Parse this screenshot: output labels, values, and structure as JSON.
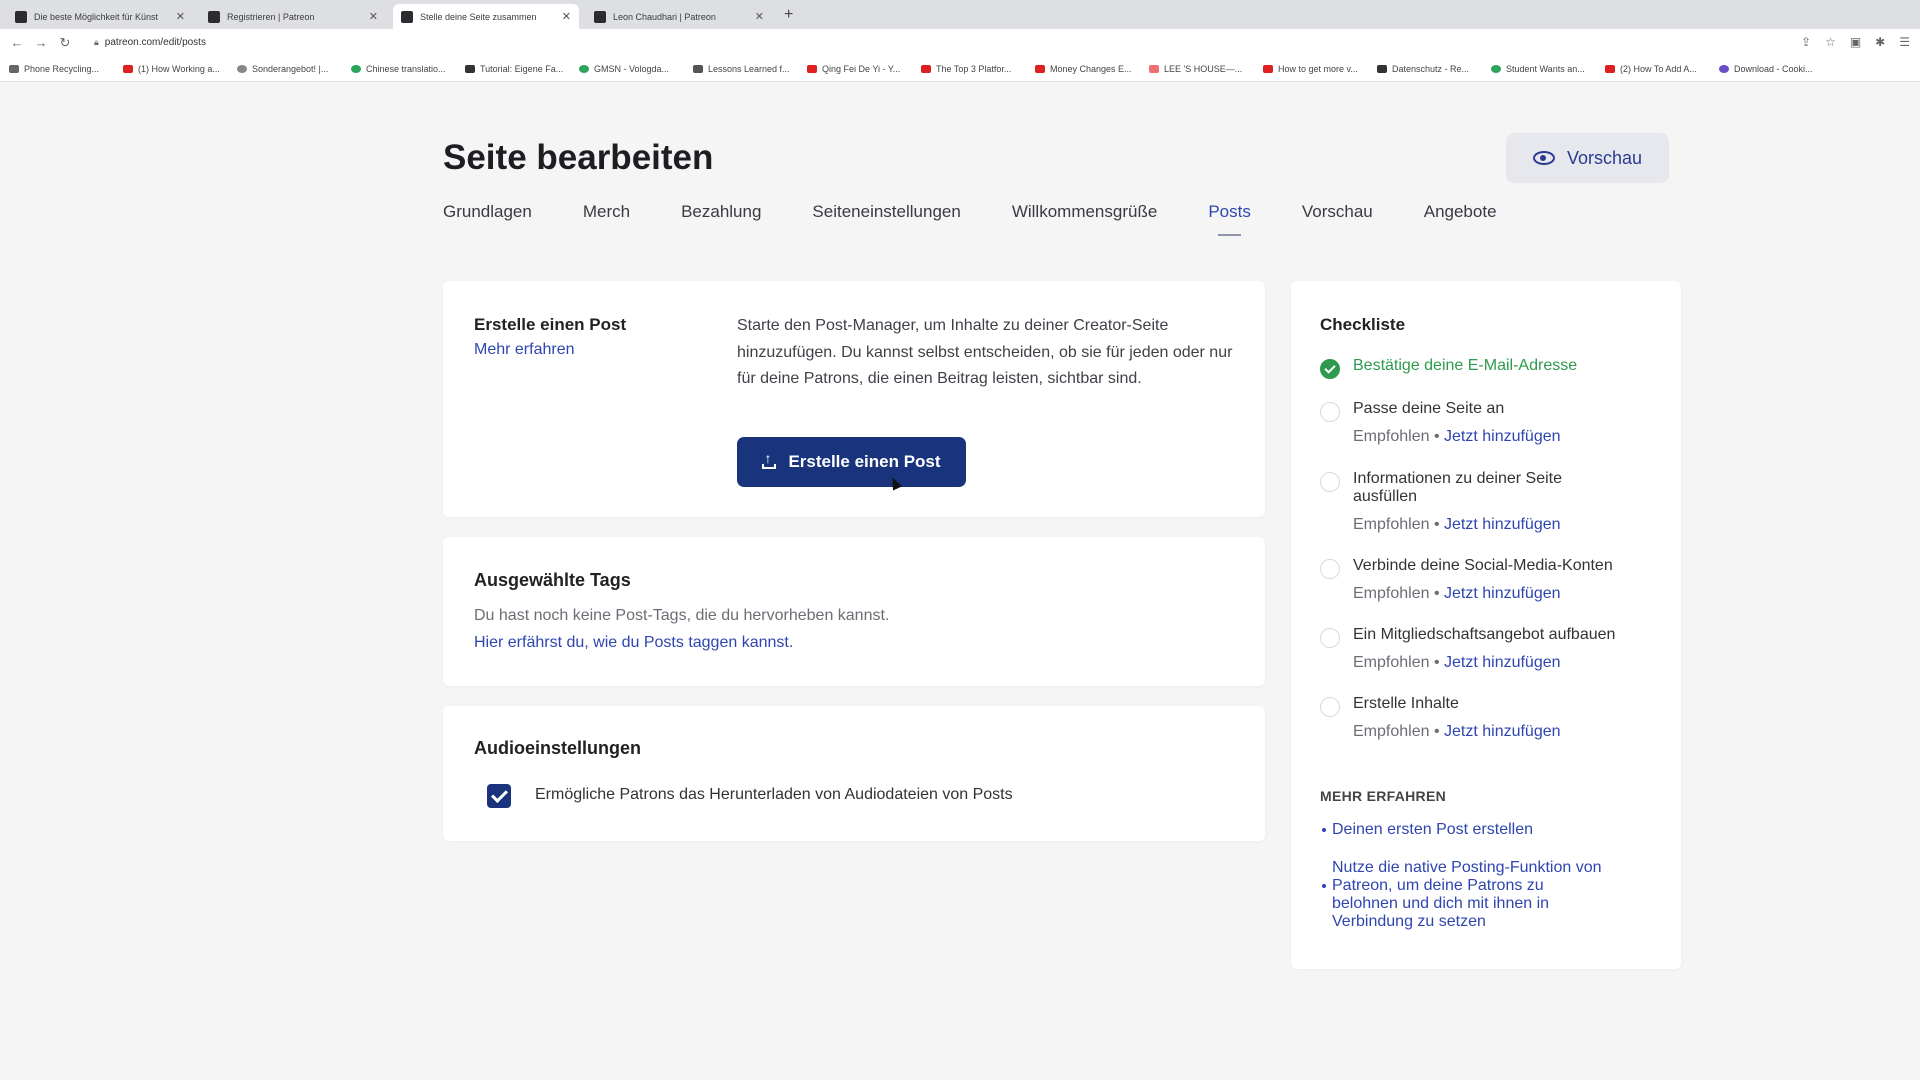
{
  "browser": {
    "tabs": [
      {
        "title": "Die beste Möglichkeit für Künst",
        "active": false
      },
      {
        "title": "Registrieren | Patreon",
        "active": false
      },
      {
        "title": "Stelle deine Seite zusammen",
        "active": true
      },
      {
        "title": "Leon Chaudhari | Patreon",
        "active": false
      }
    ],
    "url": "patreon.com/edit/posts",
    "bookmarks": [
      "Phone Recycling...",
      "(1) How Working a...",
      "Sonderangebot! |...",
      "Chinese translatio...",
      "Tutorial: Eigene Fa...",
      "GMSN - Vologda...",
      "Lessons Learned f...",
      "Qing Fei De Yi - Y...",
      "The Top 3 Platfor...",
      "Money Changes E...",
      "LEE 'S HOUSE—...",
      "How to get more v...",
      "Datenschutz - Re...",
      "Student Wants an...",
      "(2) How To Add A...",
      "Download - Cooki..."
    ]
  },
  "header": {
    "title": "Seite bearbeiten",
    "preview_label": "Vorschau"
  },
  "nav": {
    "tabs": [
      "Grundlagen",
      "Merch",
      "Bezahlung",
      "Seiteneinstellungen",
      "Willkommensgrüße",
      "Posts",
      "Vorschau",
      "Angebote"
    ],
    "active": "Posts"
  },
  "create_post": {
    "title": "Erstelle einen Post",
    "more": "Mehr erfahren",
    "description": "Starte den Post-Manager, um Inhalte zu deiner Creator-Seite hinzuzufügen. Du kannst selbst entscheiden, ob sie für jeden oder nur für deine Patrons, die einen Beitrag leisten, sichtbar sind.",
    "button": "Erstelle einen Post"
  },
  "tags": {
    "title": "Ausgewählte Tags",
    "text": "Du hast noch keine Post-Tags, die du hervorheben kannst.",
    "link": "Hier erfährst du, wie du Posts taggen kannst."
  },
  "audio": {
    "title": "Audioeinstellungen",
    "checkbox_label": "Ermögliche Patrons das Herunterladen von Audiodateien von Posts",
    "checked": true
  },
  "checklist": {
    "title": "Checkliste",
    "items": [
      {
        "label": "Bestätige deine E-Mail-Adresse",
        "done": true,
        "sub": "",
        "action": ""
      },
      {
        "label": "Passe deine Seite an",
        "done": false,
        "sub": "Empfohlen •",
        "action": "Jetzt hinzufügen"
      },
      {
        "label": "Informationen zu deiner Seite ausfüllen",
        "done": false,
        "sub": "Empfohlen •",
        "action": "Jetzt hinzufügen"
      },
      {
        "label": "Verbinde deine Social-Media-Konten",
        "done": false,
        "sub": "Empfohlen •",
        "action": "Jetzt hinzufügen"
      },
      {
        "label": "Ein Mitgliedschaftsangebot aufbauen",
        "done": false,
        "sub": "Empfohlen •",
        "action": "Jetzt hinzufügen"
      },
      {
        "label": "Erstelle Inhalte",
        "done": false,
        "sub": "Empfohlen •",
        "action": "Jetzt hinzufügen"
      }
    ],
    "learn_heading": "MEHR ERFAHREN",
    "learn_links": [
      "Deinen ersten Post erstellen",
      "Nutze die native Posting-Funktion von Patreon, um deine Patrons zu belohnen und dich mit ihnen in Verbindung zu setzen"
    ]
  },
  "colors": {
    "primary": "#19347c",
    "link": "#2f45b0",
    "success": "#2d9a4e"
  }
}
